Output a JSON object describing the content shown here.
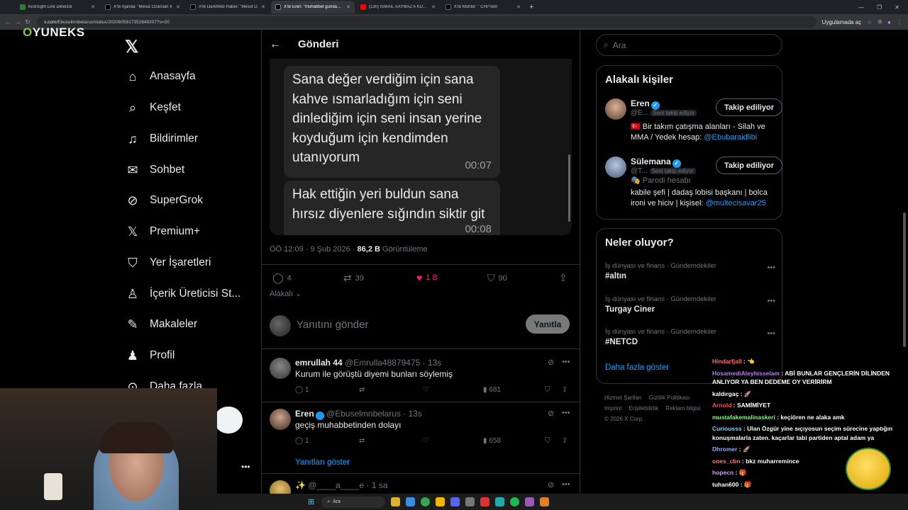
{
  "browser": {
    "tabs": [
      {
        "title": "KickSight Link Detector",
        "active": false
      },
      {
        "title": "X'te Ajanda: \"Mesut Özarslan İl",
        "active": false
      },
      {
        "title": "X'te DarkWeb Haber: \"Mesut Ö",
        "active": false
      },
      {
        "title": "X'te Eren: \"muhabbet gundan la",
        "active": true
      },
      {
        "title": "(130) İSMAİL SAYMAZ'A KONU",
        "active": false
      },
      {
        "title": "X'te Muhbir: \" CHP'den",
        "active": false
      }
    ],
    "new_tab": "+",
    "url_domain": "x.com",
    "url_path": "/Ebuselmnbelarus/status/2020605917352649207?s=20",
    "app_label": "Uygulamada aç"
  },
  "overlay": {
    "logo_prefix": "O",
    "logo_text": "YUNEKS"
  },
  "sidebar": {
    "logo_icon": "x-logo-icon",
    "items": [
      {
        "label": "Anasayfa",
        "icon": "home-icon"
      },
      {
        "label": "Keşfet",
        "icon": "search-icon"
      },
      {
        "label": "Bildirimler",
        "icon": "bell-icon"
      },
      {
        "label": "Sohbet",
        "icon": "mail-icon"
      },
      {
        "label": "SuperGrok",
        "icon": "grok-icon"
      },
      {
        "label": "Premium+",
        "icon": "x-premium-icon"
      },
      {
        "label": "Yer İşaretleri",
        "icon": "bookmark-icon"
      },
      {
        "label": "İçerik Üreticisi St...",
        "icon": "creator-icon"
      },
      {
        "label": "Makaleler",
        "icon": "article-icon"
      },
      {
        "label": "Profil",
        "icon": "profile-icon"
      },
      {
        "label": "Daha fazla",
        "icon": "more-icon"
      }
    ]
  },
  "post": {
    "header_title": "Gönderi",
    "bubbles": [
      {
        "text": "Sana değer verdiğim için sana kahve ısmarladığım için seni dinlediğim için seni insan yerine koyduğum için kendimden utanıyorum",
        "time": "00:07"
      },
      {
        "text": "Hak ettiğin yeri  buldun sana hırsız diyenlere sığındın siktir git",
        "time": "00:08"
      }
    ],
    "time": "ÖÖ 12:09 · 9 Şub 2026 · ",
    "views_count": "86,2 B",
    "views_label": " Görüntüleme",
    "stats": {
      "replies": "4",
      "reposts": "39",
      "likes": "1 B",
      "bookmarks": "90"
    },
    "sort_label": "Alakalı",
    "reply_placeholder": "Yanıtını gönder",
    "reply_button": "Yanıtla"
  },
  "replies": [
    {
      "name": "emrullah 44",
      "handle": "@Emrulla48879475 · 13s",
      "text": "Kurum ile görüştü diyemi bunları söylemiş",
      "replies": "1",
      "views": "681",
      "verified": false
    },
    {
      "name": "Eren",
      "handle": "@Ebuselmnbelarus · 13s",
      "text": "geçiş muhabbetinden dolayı",
      "replies": "1",
      "views": "658",
      "verified": true
    },
    {
      "name": "✨",
      "handle": "@____a____e · 1 sa",
      "text": "",
      "replies": "",
      "views": "",
      "verified": false
    }
  ],
  "show_replies": "Yanıtları göster",
  "right": {
    "search_placeholder": "Ara",
    "related_title": "Alakalı kişiler",
    "people": [
      {
        "name": "Eren",
        "handle": "@E...",
        "follows_you": "Seni takip ediyor",
        "bio": "🇹🇷 Bir takım çatışma alanları - Silah ve MMA / Yedek hesap: ",
        "bio_link": "@Ebubaraidlibi",
        "parody": "",
        "button": "Takip ediliyor"
      },
      {
        "name": "Sülemana",
        "handle": "@T...",
        "follows_you": "Seni takip ediyor",
        "bio": "kabile şefi | dadaş lobisi başkanı | bolca ironi ve hiciv | kişisel: ",
        "bio_link": "@multecisavar25",
        "parody": "🎭 Parodi hesabı",
        "button": "Takip ediliyor"
      }
    ],
    "trending_title": "Neler oluyor?",
    "trends": [
      {
        "category": "İş dünyası ve finans · Gündemdekiler",
        "title": "#altın"
      },
      {
        "category": "İş dünyası ve finans · Gündemdekiler",
        "title": "Turgay Ciner"
      },
      {
        "category": "İş dünyası ve finans · Gündemdekiler",
        "title": "#NETCD"
      }
    ],
    "show_more": "Daha fazla göster",
    "footer": [
      "Hizmet Şartları",
      "Gizlilik Politikası",
      "Imprint",
      "Erişilebilirlik",
      "Reklam bilgisi",
      "© 2026 X Corp."
    ]
  },
  "chat": [
    {
      "user": "Hindarfjall",
      "msg": " : 👈",
      "color": "#ff6b6b"
    },
    {
      "user": "HosamediAleyhisselam",
      "msg": " : ABİ BUNLAR GENÇLERİN DİLİNDEN ANLIYOR YA BEN DEDEME OY VERİRİRM",
      "color": "#b57bff"
    },
    {
      "user": "kaldırgaç",
      "msg": " : 🚀",
      "color": "#ffffff"
    },
    {
      "user": "Arnold",
      "msg": " : SAMİMİYET",
      "color": "#ff4d4d"
    },
    {
      "user": "mustafakemalinaskeri",
      "msg": " : keçiören ne alaka amk",
      "color": "#7cfc7c"
    },
    {
      "user": "Curiousss",
      "msg": " : Ulan Özgür yine sıçıyosun seçim sürecine yaptığın konuşmalarla zaten. kaçarlar tabi partiden aptal adam ya",
      "color": "#7fd3ff"
    },
    {
      "user": "Dhromer",
      "msg": " : 🚀",
      "color": "#8fa8ff"
    },
    {
      "user": "ones_cbn",
      "msg": " : bkz muharremince",
      "color": "#ff7a7a"
    },
    {
      "user": "hopecn",
      "msg": " : 🎁",
      "color": "#d49bff"
    },
    {
      "user": "tuhan600",
      "msg": " : 🎁",
      "color": "#ffffff"
    }
  ],
  "taskbar": {
    "search": "Ara"
  },
  "colors": {
    "accent": "#1d9bf0",
    "like": "#f91880",
    "logo_accent": "#8bc34a"
  }
}
